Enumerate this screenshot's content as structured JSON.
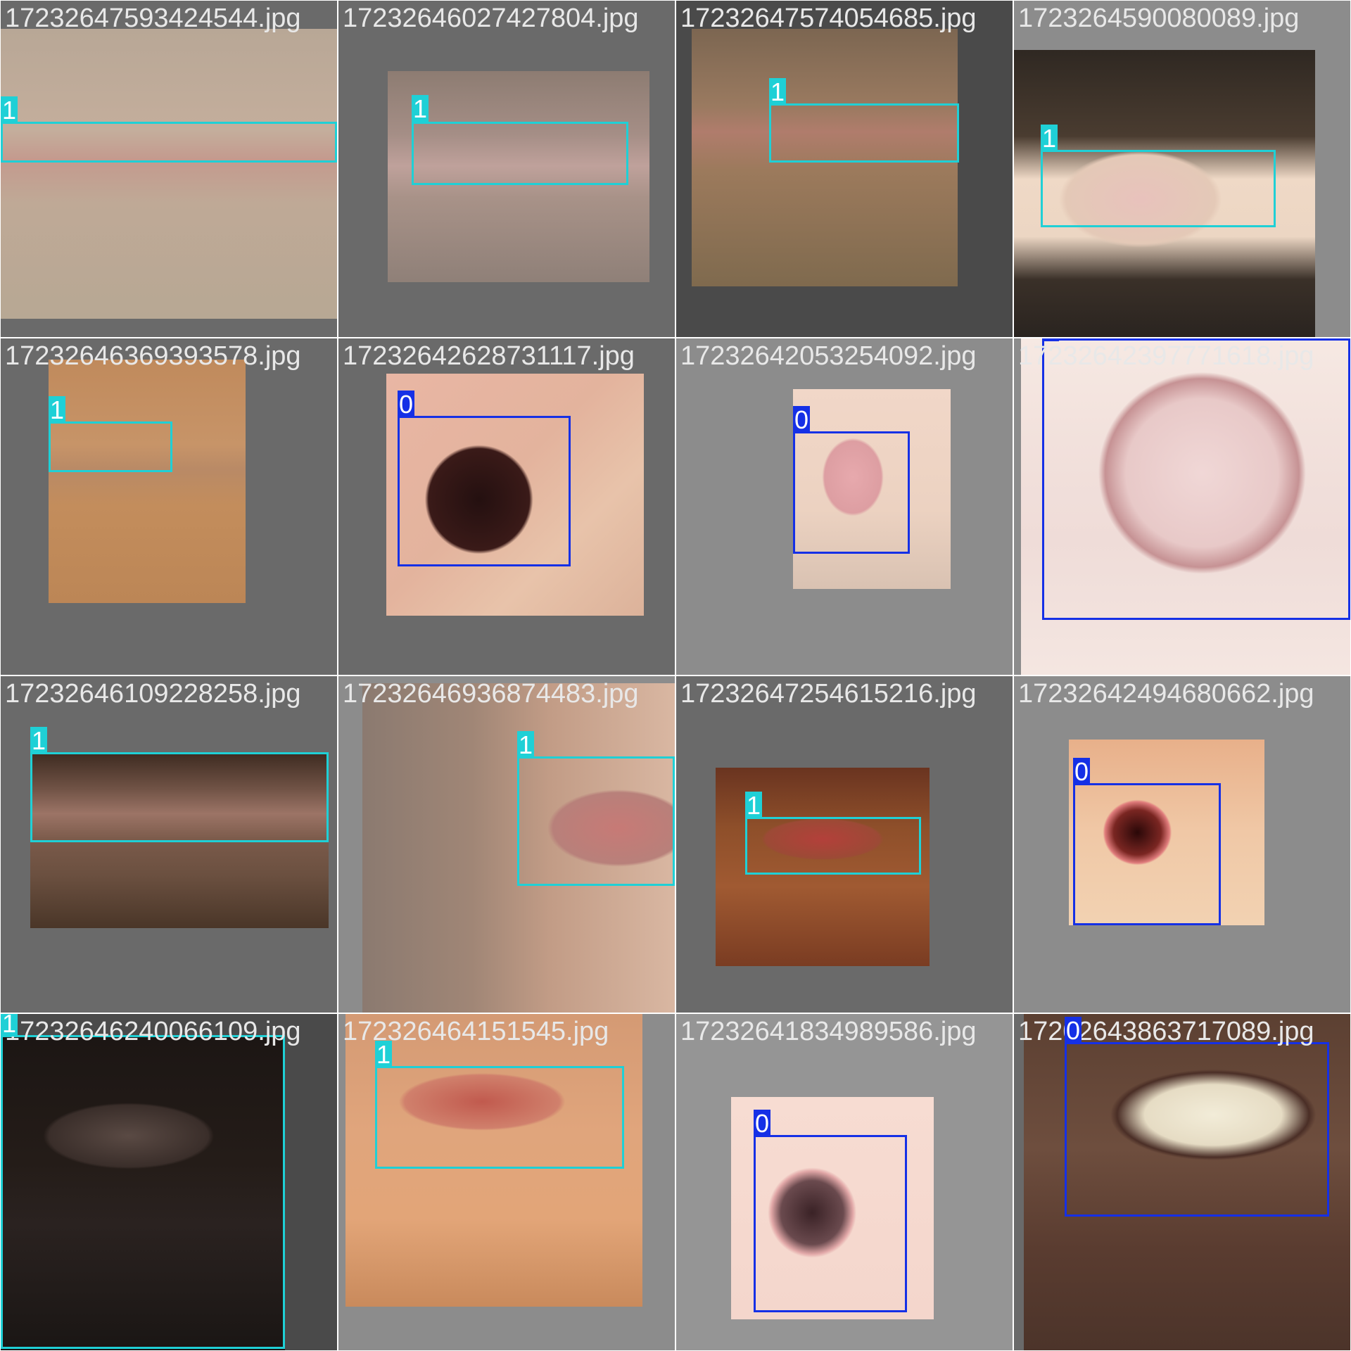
{
  "tiles": [
    {
      "filename": "17232647593424544.jpg",
      "box_label": "1"
    },
    {
      "filename": "17232646027427804.jpg",
      "box_label": "1"
    },
    {
      "filename": "17232647574054685.jpg",
      "box_label": "1"
    },
    {
      "filename": "1723264590080089.jpg",
      "box_label": "1"
    },
    {
      "filename": "17232646369393578.jpg",
      "box_label": "1"
    },
    {
      "filename": "17232642628731117.jpg",
      "box_label": "0"
    },
    {
      "filename": "17232642053254092.jpg",
      "box_label": "0"
    },
    {
      "filename": "17232642397771618.jpg",
      "box_label": "0"
    },
    {
      "filename": "17232646109228258.jpg",
      "box_label": "1"
    },
    {
      "filename": "17232646936874483.jpg",
      "box_label": "1"
    },
    {
      "filename": "17232647254615216.jpg",
      "box_label": "1"
    },
    {
      "filename": "17232642494680662.jpg",
      "box_label": "0"
    },
    {
      "filename": "17232646240066109.jpg",
      "box_label": "1"
    },
    {
      "filename": "172326464151545.jpg",
      "box_label": "1"
    },
    {
      "filename": "17232641834989586.jpg",
      "box_label": "0"
    },
    {
      "filename": "17202643863717089.jpg",
      "box_label": "0"
    }
  ],
  "colors": {
    "class_1_box": "#1fd0d6",
    "class_0_box": "#1530e6"
  }
}
